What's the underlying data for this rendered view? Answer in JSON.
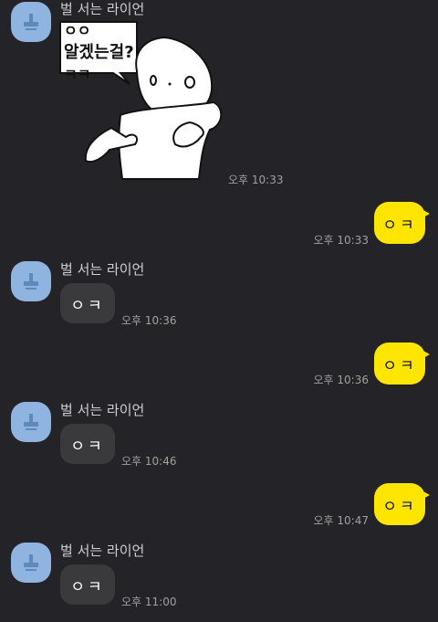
{
  "contact": {
    "name": "벌 서는 라이언"
  },
  "sticker": {
    "line1": "ㅇㅇ",
    "line2": "알겠는걸?",
    "line3": "ㅋㅋ"
  },
  "messages": [
    {
      "side": "in",
      "type": "sticker",
      "time": "오후 10:33",
      "show_name": true
    },
    {
      "side": "out",
      "text": "ㅇㅋ",
      "time": "오후 10:33"
    },
    {
      "side": "in",
      "text": "ㅇㅋ",
      "time": "오후 10:36",
      "show_name": true
    },
    {
      "side": "out",
      "text": "ㅇㅋ",
      "time": "오후 10:36"
    },
    {
      "side": "in",
      "text": "ㅇㅋ",
      "time": "오후 10:46",
      "show_name": true
    },
    {
      "side": "out",
      "text": "ㅇㅋ",
      "time": "오후 10:47"
    },
    {
      "side": "in",
      "text": "ㅇㅋ",
      "time": "오후 11:00",
      "show_name": true
    }
  ],
  "colors": {
    "background": "#242428",
    "outgoing_bubble": "#fee500",
    "incoming_bubble": "#3a3a3c",
    "avatar": "#8fb4e0"
  }
}
